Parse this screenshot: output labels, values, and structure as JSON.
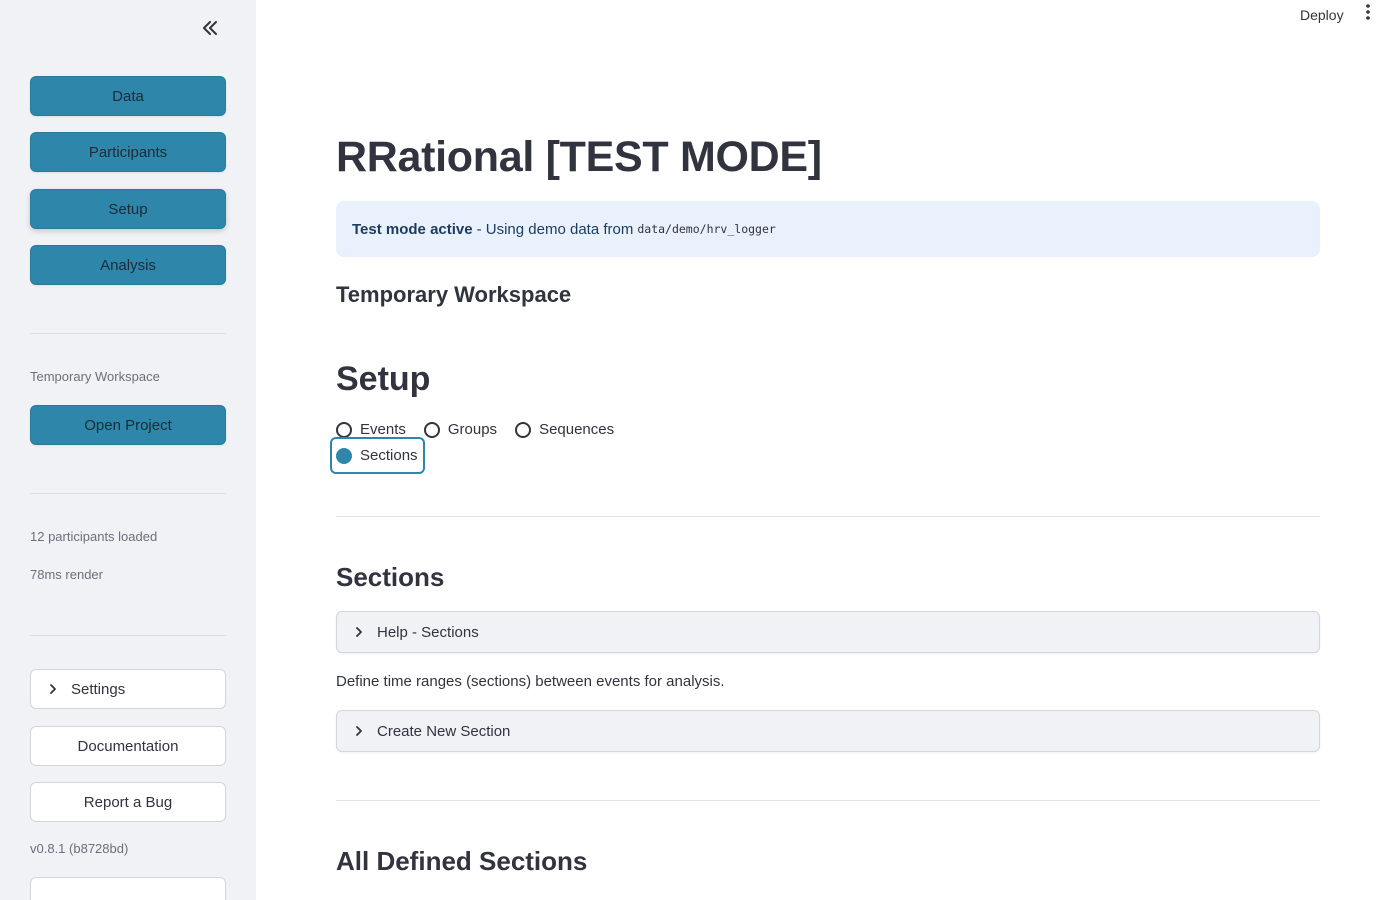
{
  "header": {
    "deploy_label": "Deploy"
  },
  "sidebar": {
    "nav": [
      {
        "label": "Data"
      },
      {
        "label": "Participants"
      },
      {
        "label": "Setup"
      },
      {
        "label": "Analysis"
      }
    ],
    "workspace_caption": "Temporary Workspace",
    "open_project_label": "Open Project",
    "participants_loaded": "12 participants loaded",
    "render_time": "78ms render",
    "settings_label": "Settings",
    "documentation_label": "Documentation",
    "report_bug_label": "Report a Bug",
    "version": "v0.8.1 (b8728bd)"
  },
  "main": {
    "title": "RRational [TEST MODE]",
    "info": {
      "bold": "Test mode active",
      "text": "- Using demo data from",
      "code": "data/demo/hrv_logger"
    },
    "workspace_heading": "Temporary Workspace",
    "setup_heading": "Setup",
    "radio_options": [
      "Events",
      "Groups",
      "Sequences",
      "Sections"
    ],
    "selected_option": "Sections",
    "sections_heading": "Sections",
    "help_expander": "Help - Sections",
    "description": "Define time ranges (sections) between events for analysis.",
    "create_expander": "Create New Section",
    "all_sections_heading": "All Defined Sections"
  },
  "colors": {
    "primary": "#2e86ab",
    "sidebar_bg": "#f0f2f6",
    "info_bg": "#e8f1fc"
  }
}
